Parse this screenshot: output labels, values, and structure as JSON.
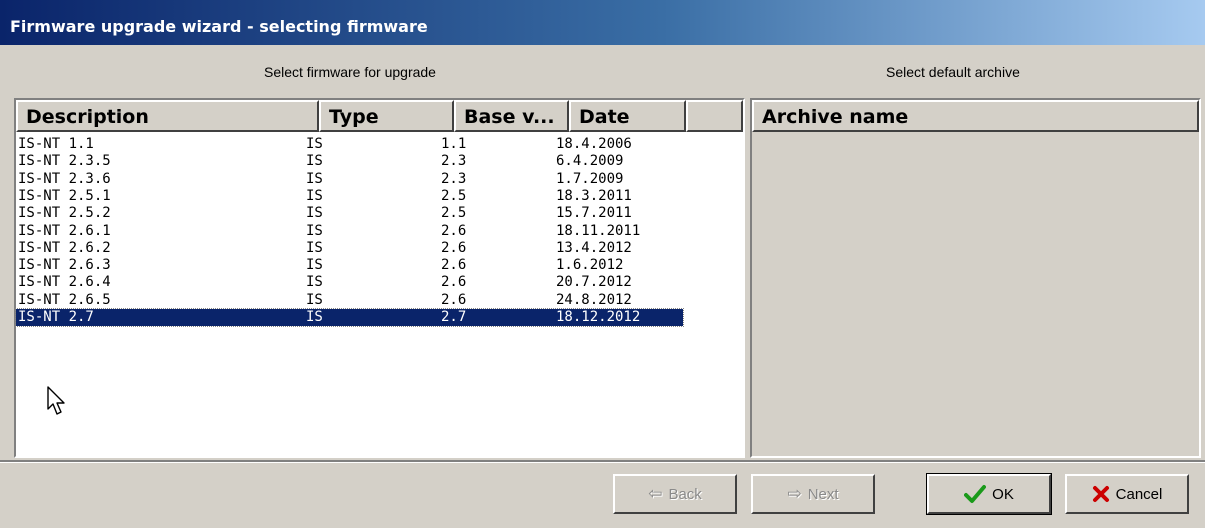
{
  "window": {
    "title": "Firmware upgrade wizard - selecting firmware"
  },
  "firmware_panel": {
    "label": "Select firmware for upgrade",
    "columns": [
      "Description",
      "Type",
      "Base v...",
      "Date"
    ],
    "rows": [
      {
        "description": "IS-NT 1.1",
        "type": "IS",
        "base": "1.1",
        "date": "18.4.2006"
      },
      {
        "description": "IS-NT 2.3.5",
        "type": "IS",
        "base": "2.3",
        "date": "6.4.2009"
      },
      {
        "description": "IS-NT 2.3.6",
        "type": "IS",
        "base": "2.3",
        "date": "1.7.2009"
      },
      {
        "description": "IS-NT 2.5.1",
        "type": "IS",
        "base": "2.5",
        "date": "18.3.2011"
      },
      {
        "description": "IS-NT 2.5.2",
        "type": "IS",
        "base": "2.5",
        "date": "15.7.2011"
      },
      {
        "description": "IS-NT 2.6.1",
        "type": "IS",
        "base": "2.6",
        "date": "18.11.2011"
      },
      {
        "description": "IS-NT 2.6.2",
        "type": "IS",
        "base": "2.6",
        "date": "13.4.2012"
      },
      {
        "description": "IS-NT 2.6.3",
        "type": "IS",
        "base": "2.6",
        "date": "1.6.2012"
      },
      {
        "description": "IS-NT 2.6.4",
        "type": "IS",
        "base": "2.6",
        "date": "20.7.2012"
      },
      {
        "description": "IS-NT 2.6.5",
        "type": "IS",
        "base": "2.6",
        "date": "24.8.2012"
      },
      {
        "description": "IS-NT 2.7",
        "type": "IS",
        "base": "2.7",
        "date": "18.12.2012",
        "selected": true
      }
    ]
  },
  "archive_panel": {
    "label": "Select default archive",
    "columns": [
      "Archive name"
    ]
  },
  "buttons": {
    "back": "Back",
    "next": "Next",
    "ok": "OK",
    "cancel": "Cancel"
  },
  "colors": {
    "selection": "#0a246a",
    "ok_check": "#1a9a1a",
    "cancel_x": "#cc0000"
  }
}
